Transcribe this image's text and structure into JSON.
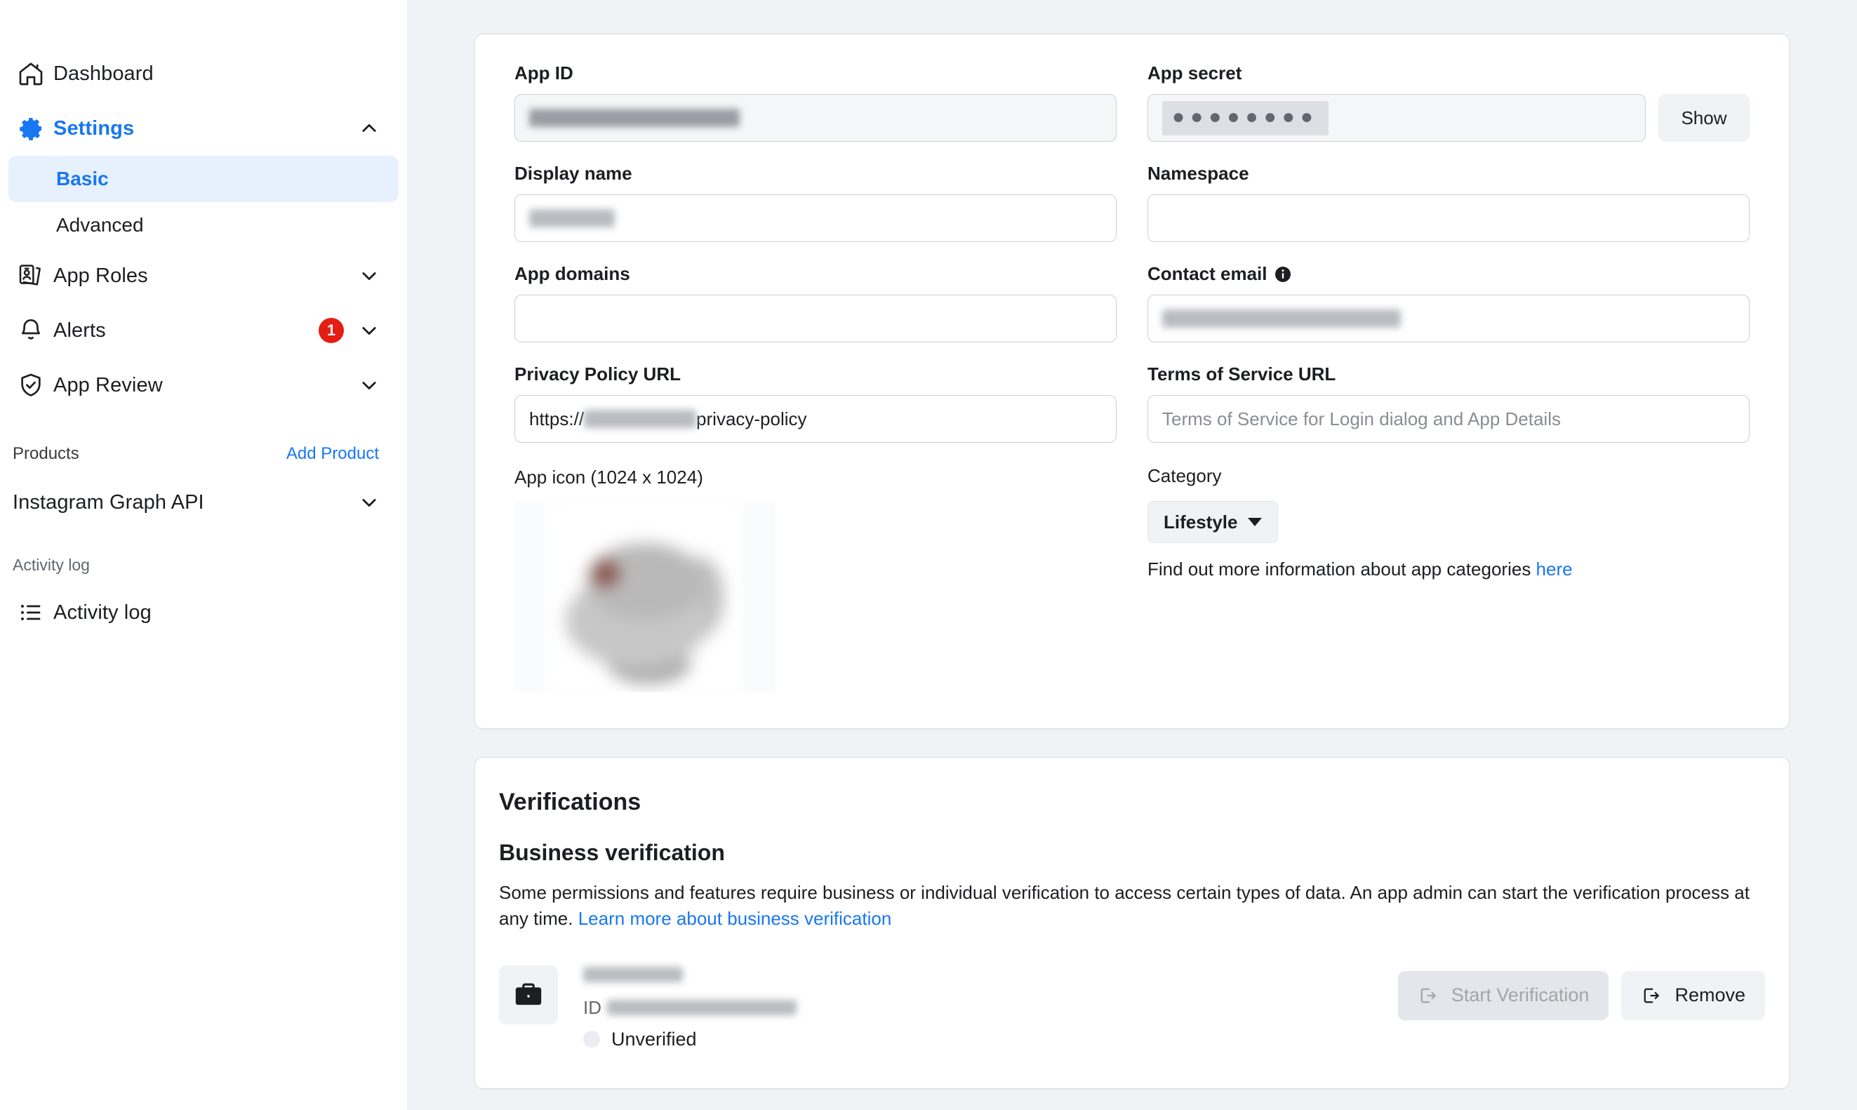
{
  "sidebar": {
    "nav": [
      {
        "label": "Dashboard",
        "icon": "home-icon",
        "chevron": null,
        "badge": null,
        "active": false
      },
      {
        "label": "Settings",
        "icon": "gear-icon",
        "chevron": "up",
        "badge": null,
        "active": true
      },
      {
        "label": "App Roles",
        "icon": "app-roles-icon",
        "chevron": "down",
        "badge": null,
        "active": false
      },
      {
        "label": "Alerts",
        "icon": "bell-icon",
        "chevron": "down",
        "badge": "1",
        "active": false
      },
      {
        "label": "App Review",
        "icon": "shield-check-icon",
        "chevron": "down",
        "badge": null,
        "active": false
      }
    ],
    "settings_children": [
      {
        "label": "Basic",
        "active": true
      },
      {
        "label": "Advanced",
        "active": false
      }
    ],
    "products_header": {
      "title": "Products",
      "action": "Add Product"
    },
    "products": [
      {
        "label": "Instagram Graph API",
        "chevron": "down"
      }
    ],
    "activity_header": "Activity log",
    "activity_item": {
      "label": "Activity log",
      "icon": "list-icon"
    }
  },
  "basic": {
    "app_id": {
      "label": "App ID",
      "value_redacted": true,
      "readonly": true
    },
    "app_secret": {
      "label": "App secret",
      "value": "●●●●●●●●",
      "show_button": "Show",
      "readonly": true
    },
    "display_name": {
      "label": "Display name",
      "value_redacted": true
    },
    "namespace": {
      "label": "Namespace",
      "value": "",
      "placeholder": ""
    },
    "app_domains": {
      "label": "App domains",
      "value": "",
      "placeholder": ""
    },
    "contact_email": {
      "label": "Contact email",
      "info_icon": "info-icon",
      "value_redacted": true
    },
    "privacy_policy": {
      "label": "Privacy Policy URL",
      "value_prefix": "https://",
      "value_redacted_middle": true,
      "value_suffix": "privacy-policy"
    },
    "terms_of_service": {
      "label": "Terms of Service URL",
      "value": "",
      "placeholder": "Terms of Service for Login dialog and App Details"
    },
    "app_icon": {
      "label": "App icon (1024 x 1024)",
      "image_redacted": true
    },
    "category": {
      "label": "Category",
      "selected": "Lifestyle",
      "note_prefix": "Find out more information about app categories ",
      "note_link": "here"
    }
  },
  "verifications": {
    "title": "Verifications",
    "business": {
      "subtitle": "Business verification",
      "body_prefix": "Some permissions and features require business or individual verification to access certain types of data. An app admin can start the verification process at any time. ",
      "body_link": "Learn more about business verification",
      "entity": {
        "icon": "briefcase-icon",
        "name_redacted": true,
        "id_label": "ID",
        "id_redacted": true,
        "status": "Unverified",
        "status_dot_color": "#ebedf0"
      },
      "actions": [
        {
          "label": "Start Verification",
          "icon": "export-icon",
          "disabled": true
        },
        {
          "label": "Remove",
          "icon": "export-icon",
          "disabled": false
        }
      ]
    }
  },
  "colors": {
    "brand_blue": "#1877f2",
    "badge_red": "#e41e12",
    "page_bg": "#f0f2f5",
    "active_nav_bg": "#e7f0fd"
  }
}
